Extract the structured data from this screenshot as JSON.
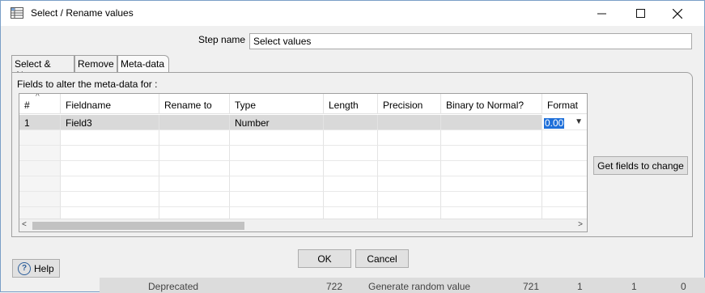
{
  "window": {
    "title": "Select / Rename values",
    "minimize": "—",
    "maximize": "☐",
    "close": "✕"
  },
  "step": {
    "label": "Step name",
    "value": "Select values"
  },
  "tabs": [
    {
      "label": "Select & Alter",
      "active": false
    },
    {
      "label": "Remove",
      "active": false
    },
    {
      "label": "Meta-data",
      "active": true
    }
  ],
  "panel": {
    "fields_label": "Fields to alter the meta-data for :",
    "get_fields_button": "Get fields to change"
  },
  "table": {
    "columns": [
      "#",
      "Fieldname",
      "Rename to",
      "Type",
      "Length",
      "Precision",
      "Binary to Normal?",
      "Format"
    ],
    "rows": [
      {
        "num": "1",
        "fieldname": "Field3",
        "rename": "",
        "type": "Number",
        "length": "",
        "precision": "",
        "binary": "",
        "format": "0.00"
      }
    ]
  },
  "buttons": {
    "ok": "OK",
    "cancel": "Cancel",
    "help": "Help"
  },
  "background": {
    "item1": "Deprecated",
    "item2": "722",
    "item3": "Generate random value",
    "item4": "721",
    "item5": "1",
    "item6": "1",
    "item7": "0"
  },
  "icons": {
    "app": "grid-icon",
    "help": "question-icon"
  }
}
